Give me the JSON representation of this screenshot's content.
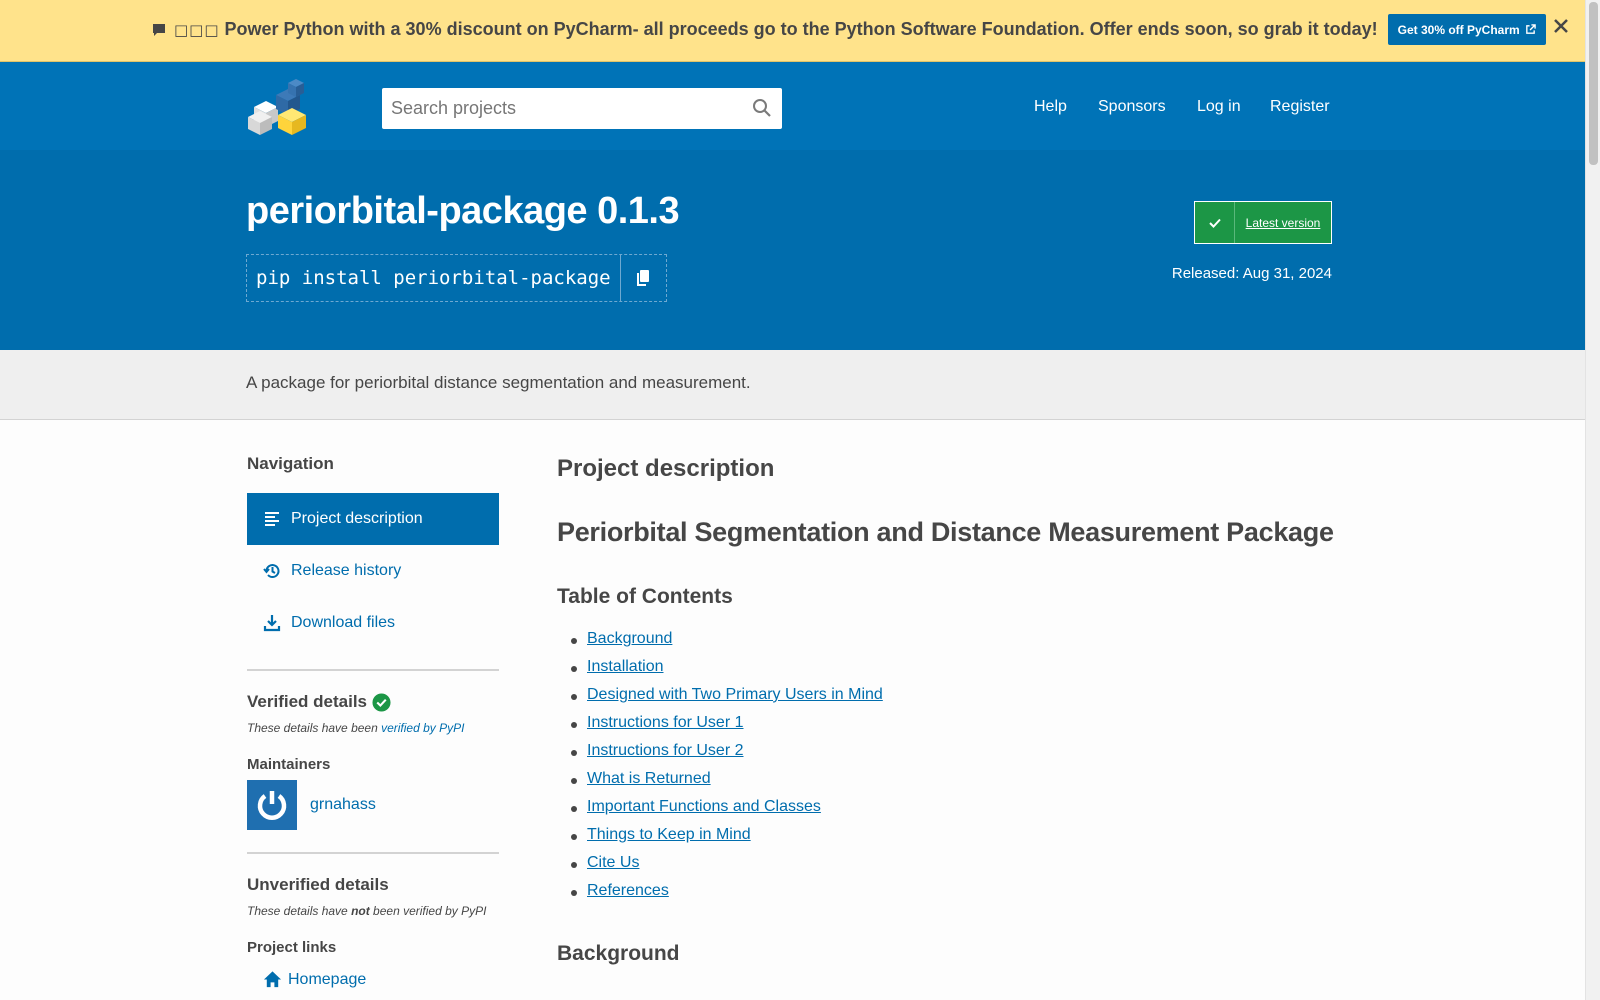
{
  "banner": {
    "icon": "comment-icon",
    "boxes": "□□□",
    "text": "Power Python with a 30% discount on PyCharm- all proceeds go to the Python Software Foundation. Offer ends soon, so grab it today!",
    "button_label": "Get 30% off PyCharm",
    "background": "#ffe38b"
  },
  "header": {
    "search_placeholder": "Search projects",
    "nav": [
      "Help",
      "Sponsors",
      "Log in",
      "Register"
    ],
    "color": "#0073b7"
  },
  "package": {
    "title": "periorbital-package 0.1.3",
    "pip_command": "pip install periorbital-package",
    "latest_label": "Latest version",
    "released": "Released: Aug 31, 2024"
  },
  "summary": "A package for periorbital distance segmentation and measurement.",
  "sidebar": {
    "navigation_heading": "Navigation",
    "nav_items": [
      "Project description",
      "Release history",
      "Download files"
    ],
    "verified_heading": "Verified details",
    "verified_note_prefix": "These details have been ",
    "verified_note_link": "verified by PyPI",
    "maintainers_heading": "Maintainers",
    "maintainer": "grnahass",
    "unverified_heading": "Unverified details",
    "unverified_note_prefix": "These details have ",
    "unverified_note_bold": "not",
    "unverified_note_suffix": " been verified by PyPI",
    "project_links_heading": "Project links",
    "homepage": "Homepage"
  },
  "main": {
    "project_description_heading": "Project description",
    "package_heading": "Periorbital Segmentation and Distance Measurement Package",
    "toc_heading": "Table of Contents",
    "toc": [
      "Background",
      "Installation",
      "Designed with Two Primary Users in Mind",
      "Instructions for User 1",
      "Instructions for User 2",
      "What is Returned",
      "Important Functions and Classes",
      "Things to Keep in Mind",
      "Cite Us",
      "References"
    ],
    "background_heading": "Background"
  }
}
